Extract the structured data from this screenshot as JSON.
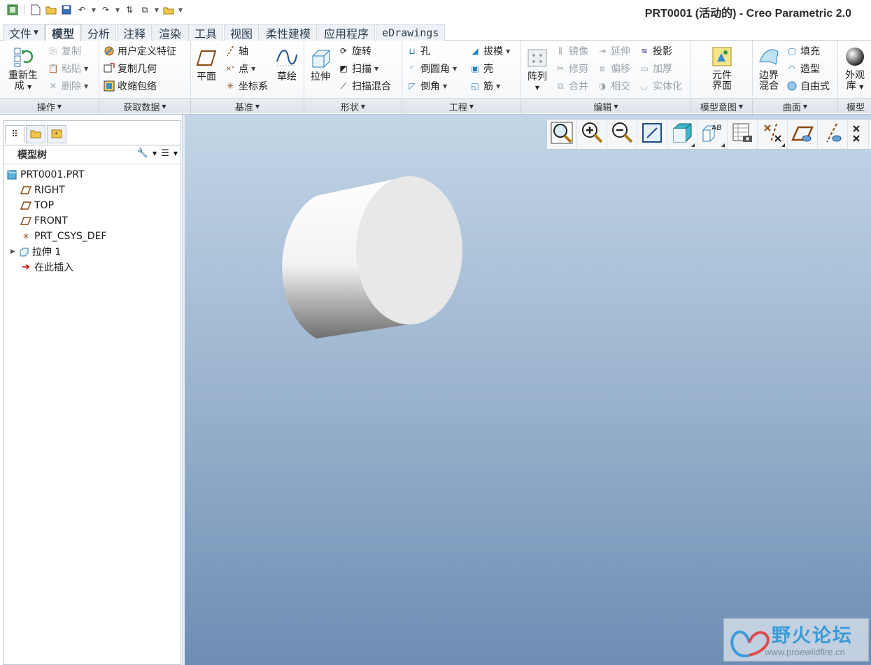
{
  "window": {
    "title": "PRT0001 (活动的) - Creo Parametric 2.0"
  },
  "menu_tabs": [
    "文件",
    "模型",
    "分析",
    "注释",
    "渲染",
    "工具",
    "视图",
    "柔性建模",
    "应用程序",
    "eDrawings"
  ],
  "ribbon": {
    "operations": {
      "regenerate_line1": "重新生",
      "regenerate_line2": "成",
      "copy": "复制",
      "paste": "粘贴",
      "delete": "删除",
      "label": "操作"
    },
    "get_data": {
      "udf": "用户定义特征",
      "copy_geom": "复制几何",
      "shrinkwrap": "收缩包络",
      "label": "获取数据"
    },
    "datum": {
      "plane": "平面",
      "axis": "轴",
      "point": "点",
      "csys": "坐标系",
      "sketch": "草绘",
      "label": "基准"
    },
    "shapes": {
      "extrude": "拉伸",
      "revolve": "旋转",
      "sweep": "扫描",
      "swept_blend": "扫描混合",
      "label": "形状"
    },
    "engineering": {
      "hole": "孔",
      "round": "倒圆角",
      "chamfer": "倒角",
      "draft": "拔模",
      "shell": "壳",
      "rib": "筋",
      "label": "工程"
    },
    "editing": {
      "pattern": "阵列",
      "mirror": "镜像",
      "trim": "修剪",
      "merge": "合并",
      "extend": "延伸",
      "offset": "偏移",
      "intersect": "相交",
      "project": "投影",
      "thicken": "加厚",
      "solidify": "实体化",
      "label": "编辑"
    },
    "model_intent": {
      "component_interface_line1": "元件",
      "component_interface_line2": "界面",
      "label": "模型意图"
    },
    "surfaces": {
      "boundary_blend_line1": "边界",
      "boundary_blend_line2": "混合",
      "fill": "填充",
      "style": "造型",
      "freestyle": "自由式",
      "label": "曲面"
    },
    "appearance": {
      "lib_line1": "外观",
      "lib_line2": "库",
      "label": "模型"
    }
  },
  "model_tree": {
    "title": "模型树",
    "items": [
      "PRT0001.PRT",
      "RIGHT",
      "TOP",
      "FRONT",
      "PRT_CSYS_DEF",
      "拉伸 1",
      "在此插入"
    ]
  },
  "watermark": {
    "name": "野火论坛",
    "url": "www.proewildfire.cn"
  },
  "colors": {
    "accent": "#2e8bc0",
    "viewport_top": "#c3d6e7",
    "viewport_bottom": "#6e8db4",
    "datum_plane": "#8b4a12",
    "insert_arrow": "#c00000"
  }
}
